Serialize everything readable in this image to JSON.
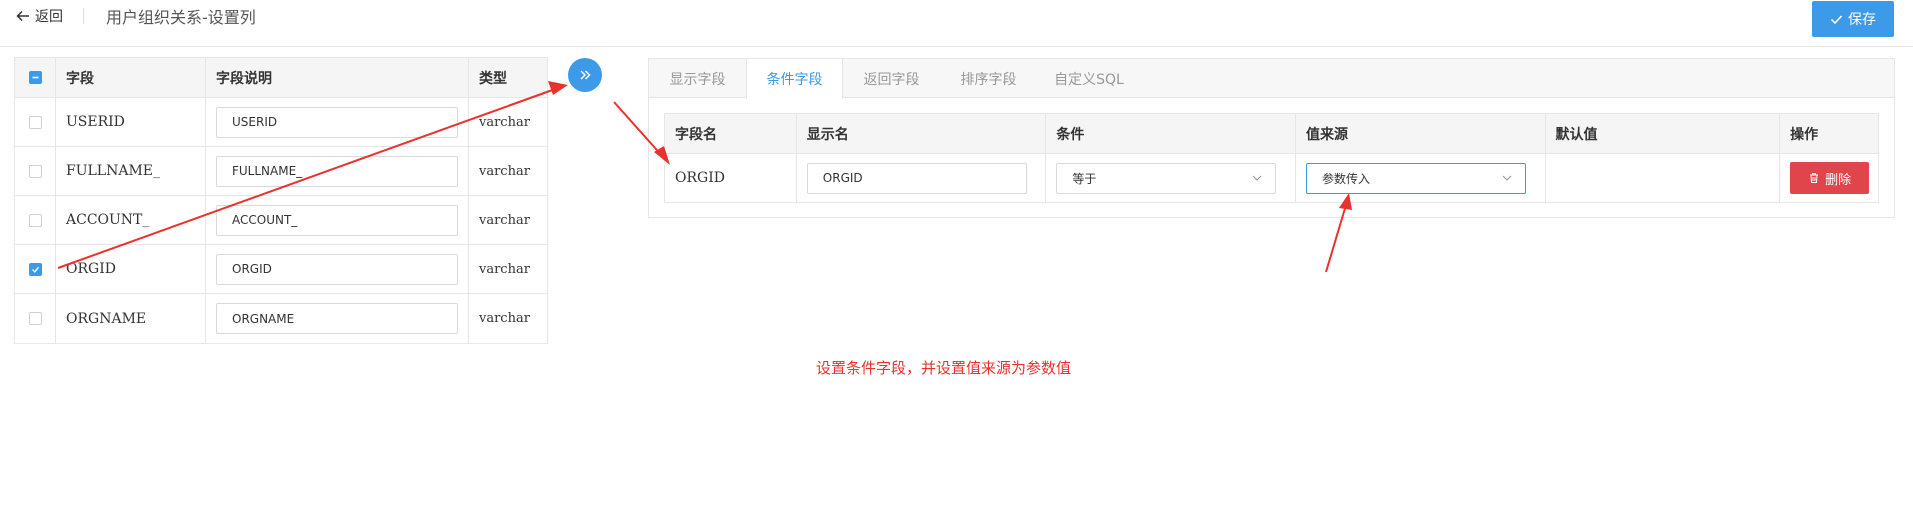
{
  "header": {
    "back_label": "返回",
    "title": "用户组织关系-设置列",
    "save_label": "保存"
  },
  "left_table": {
    "columns": [
      "字段",
      "字段说明",
      "类型"
    ],
    "rows": [
      {
        "field": "USERID",
        "desc": "USERID",
        "type": "varchar",
        "checked": false
      },
      {
        "field": "FULLNAME_",
        "desc": "FULLNAME_",
        "type": "varchar",
        "checked": false
      },
      {
        "field": "ACCOUNT_",
        "desc": "ACCOUNT_",
        "type": "varchar",
        "checked": false
      },
      {
        "field": "ORGID",
        "desc": "ORGID",
        "type": "varchar",
        "checked": true
      },
      {
        "field": "ORGNAME",
        "desc": "ORGNAME",
        "type": "varchar",
        "checked": false
      }
    ]
  },
  "tabs": [
    {
      "label": "显示字段",
      "active": false
    },
    {
      "label": "条件字段",
      "active": true
    },
    {
      "label": "返回字段",
      "active": false
    },
    {
      "label": "排序字段",
      "active": false
    },
    {
      "label": "自定义SQL",
      "active": false
    }
  ],
  "condition_table": {
    "columns": [
      "字段名",
      "显示名",
      "条件",
      "值来源",
      "默认值",
      "操作"
    ],
    "rows": [
      {
        "field": "ORGID",
        "display_name": "ORGID",
        "condition": "等于",
        "value_source": "参数传入",
        "default_value": "",
        "action_label": "删除"
      }
    ]
  },
  "annotation_note": "设置条件字段，并设置值来源为参数值",
  "colors": {
    "primary": "#3d9ae8",
    "danger": "#e0454c",
    "annotation": "#e8322e"
  }
}
